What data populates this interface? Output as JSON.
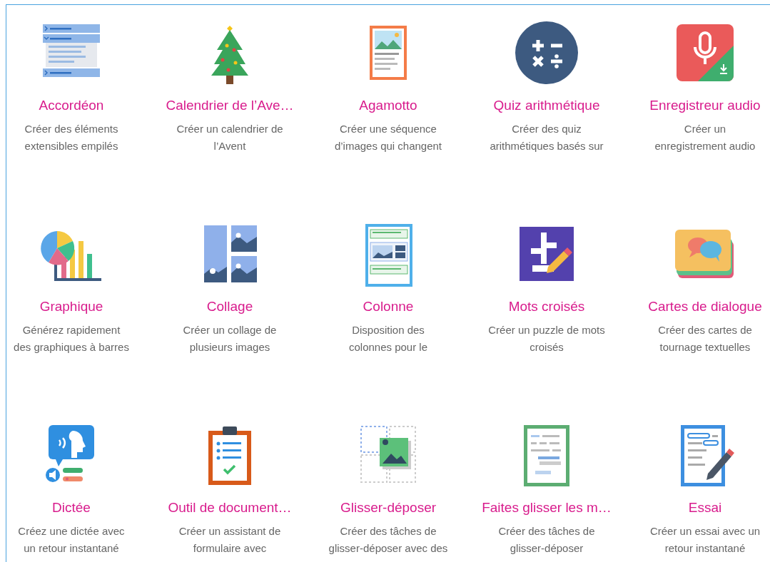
{
  "content_types": [
    {
      "title": "Accordéon",
      "description": "Créer des éléments\nextensibles empilés"
    },
    {
      "title": "Calendrier de l’Ave…",
      "description": "Créer un calendrier de\nl’Avent"
    },
    {
      "title": "Agamotto",
      "description": "Créer une séquence\nd’images qui changent"
    },
    {
      "title": "Quiz arithmétique",
      "description": "Créer des quiz\narithmétiques basés sur"
    },
    {
      "title": "Enregistreur audio",
      "description": "Créer un\nenregistrement audio"
    },
    {
      "title": "Graphique",
      "description": "Générez rapidement\ndes graphiques à barres"
    },
    {
      "title": "Collage",
      "description": "Créer un collage de\nplusieurs images"
    },
    {
      "title": "Colonne",
      "description": "Disposition des\ncolonnes pour le"
    },
    {
      "title": "Mots croisés",
      "description": "Créer un puzzle de mots\ncroisés"
    },
    {
      "title": "Cartes de dialogue",
      "description": "Créer des cartes de\ntournage textuelles"
    },
    {
      "title": "Dictée",
      "description": "Créez une dictée avec\nun retour instantané"
    },
    {
      "title": "Outil de document…",
      "description": "Créer un assistant de\nformulaire avec"
    },
    {
      "title": "Glisser-déposer",
      "description": "Créer des tâches de\nglisser-déposer avec des"
    },
    {
      "title": "Faites glisser les m…",
      "description": "Créer des tâches de\nglisser-déposer"
    },
    {
      "title": "Essai",
      "description": "Créer un essai avec un\nretour instantané"
    }
  ]
}
